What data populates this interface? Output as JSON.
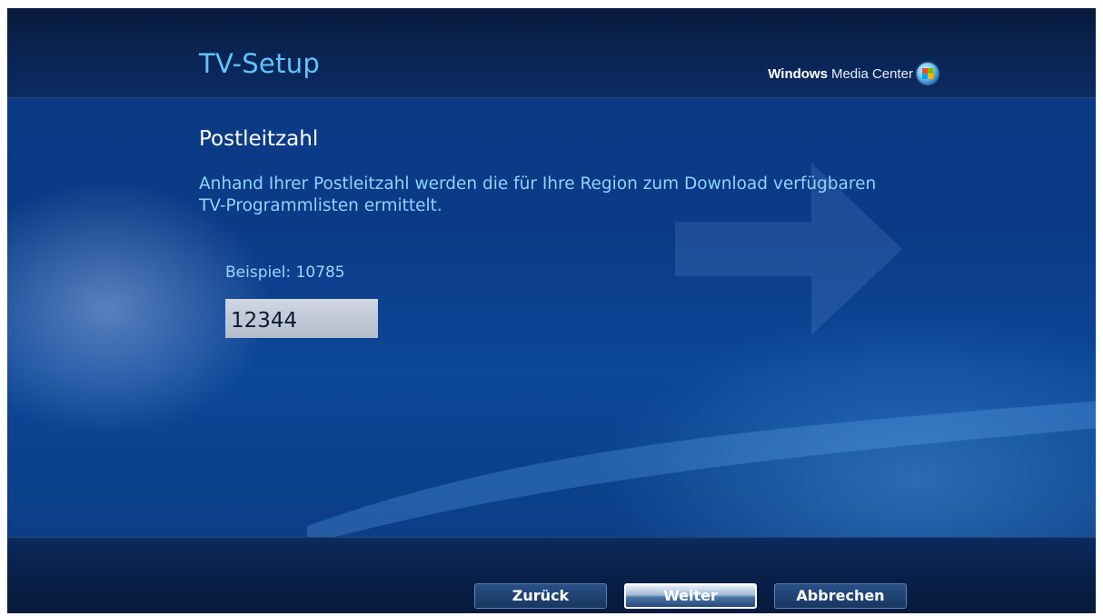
{
  "header": {
    "title": "TV-Setup",
    "brand_strong": "Windows",
    "brand_light": "Media Center",
    "brand_icon": "windows-orb-icon"
  },
  "main": {
    "section_title": "Postleitzahl",
    "description": "Anhand Ihrer Postleitzahl werden die für Ihre Region zum Download verfügbaren TV-Programmlisten ermittelt.",
    "example_label": "Beispiel: 10785",
    "zip_value": "12344"
  },
  "footer": {
    "back_label": "Zurück",
    "next_label": "Weiter",
    "cancel_label": "Abbrechen"
  },
  "colors": {
    "title_blue": "#62c3ff",
    "text_blue": "#8fd3ff",
    "background": "#0b3a86"
  }
}
